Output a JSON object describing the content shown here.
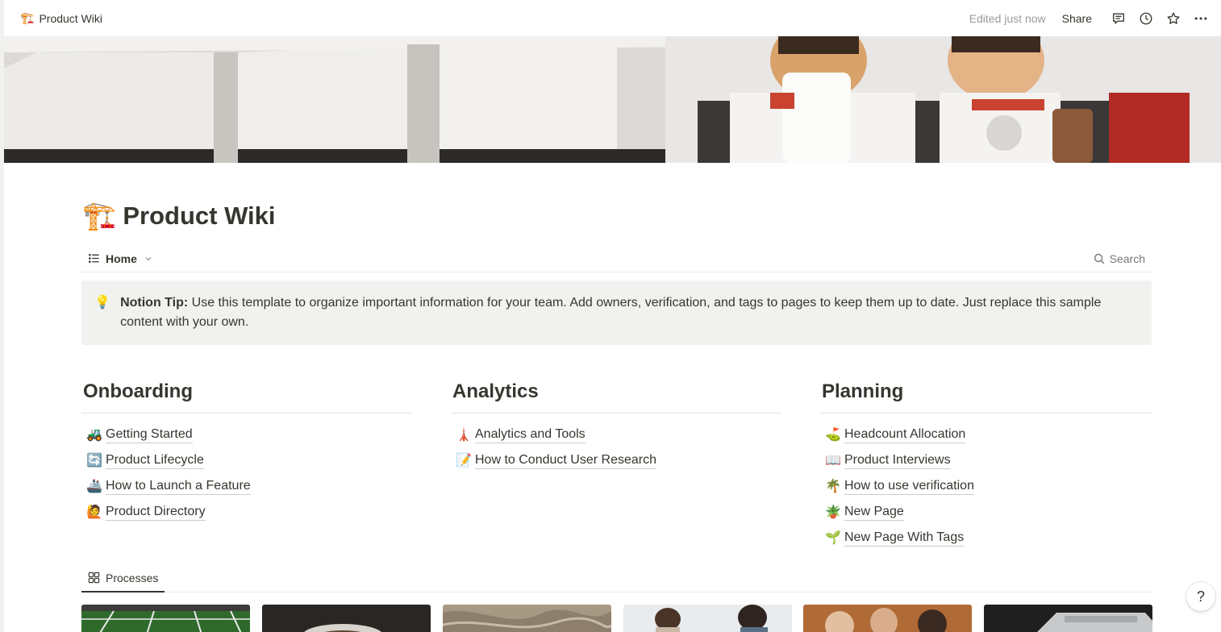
{
  "topbar": {
    "breadcrumb_emoji": "🏗️",
    "breadcrumb_title": "Product Wiki",
    "edited": "Edited just now",
    "share": "Share",
    "icons": [
      "comment-icon",
      "clock-icon",
      "star-icon",
      "more-icon"
    ]
  },
  "page": {
    "emoji": "🏗️",
    "title": "Product Wiki"
  },
  "view": {
    "tab_label": "Home",
    "search_label": "Search"
  },
  "callout": {
    "emoji": "💡",
    "bold": "Notion Tip:",
    "text": " Use this template to organize important information for your team. Add owners, verification, and tags to pages to keep them up to date. Just replace this sample content with your own."
  },
  "sections": [
    {
      "heading": "Onboarding",
      "links": [
        {
          "emoji": "🚜",
          "label": "Getting Started"
        },
        {
          "emoji": "🔄",
          "label": "Product Lifecycle"
        },
        {
          "emoji": "🚢",
          "label": "How to Launch a Feature"
        },
        {
          "emoji": "🙋",
          "label": "Product Directory"
        }
      ]
    },
    {
      "heading": "Analytics",
      "links": [
        {
          "emoji": "🗼",
          "label": "Analytics and Tools"
        },
        {
          "emoji": "📝",
          "label": "How to Conduct User Research"
        }
      ]
    },
    {
      "heading": "Planning",
      "links": [
        {
          "emoji": "⛳",
          "label": "Headcount Allocation"
        },
        {
          "emoji": "📖",
          "label": "Product Interviews"
        },
        {
          "emoji": "🌴",
          "label": "How to use verification"
        },
        {
          "emoji": "🪴",
          "label": "New Page"
        },
        {
          "emoji": "🌱",
          "label": "New Page With Tags"
        }
      ]
    }
  ],
  "processes": {
    "tab_label": "Processes"
  },
  "help": {
    "label": "?"
  },
  "colors": {
    "text": "#37352f",
    "muted": "#9b9a97",
    "callout_bg": "#f1f1ef",
    "divider": "#e9e9e7"
  }
}
